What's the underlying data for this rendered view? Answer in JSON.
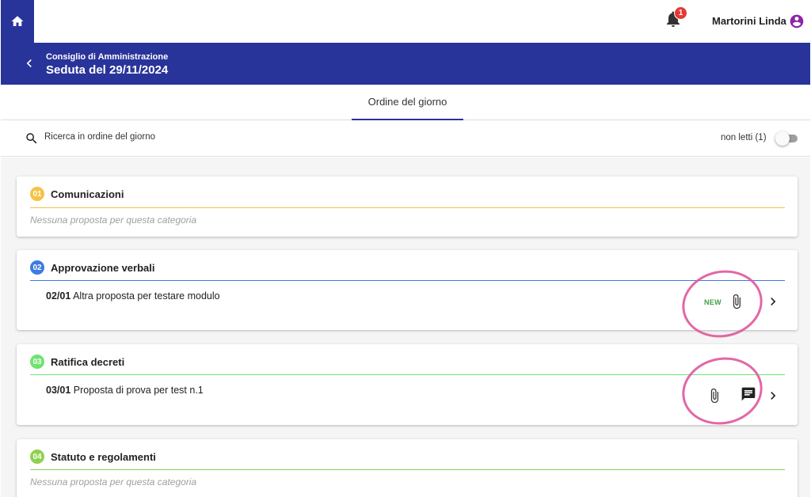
{
  "topbar": {
    "home_icon": "home-icon",
    "notification_count": "1",
    "user_name": "Martorini Linda"
  },
  "header": {
    "subtitle": "Consiglio di Amministrazione",
    "title": "Seduta del 29/11/2024"
  },
  "tabs": [
    {
      "label": "Ordine del giorno",
      "active": true
    }
  ],
  "search": {
    "placeholder": "Ricerca in ordine del giorno",
    "unread_label": "non letti (1)",
    "unread_toggle_on": false
  },
  "categories": [
    {
      "number": "01",
      "title": "Comunicazioni",
      "color": "#f5c242",
      "empty_text": "Nessuna proposta per questa categoria",
      "proposals": []
    },
    {
      "number": "02",
      "title": "Approvazione verbali",
      "color": "#3d7be0",
      "proposals": [
        {
          "code": "02/01",
          "text": "Altra proposta per testare modulo",
          "badge": "NEW",
          "icons": [
            "attachment-icon",
            "chevron-right-icon"
          ]
        }
      ]
    },
    {
      "number": "03",
      "title": "Ratifica decreti",
      "color": "#6ee36e",
      "proposals": [
        {
          "code": "03/01",
          "text": "Proposta di prova per test n.1",
          "icons": [
            "attachment-icon",
            "comment-icon",
            "chevron-right-icon"
          ]
        }
      ]
    },
    {
      "number": "04",
      "title": "Statuto e regolamenti",
      "color": "#8fd14f",
      "empty_text": "Nessuna proposta per questa categoria",
      "proposals": []
    }
  ],
  "colors": {
    "primary": "#29349a",
    "badge_red": "#e53935",
    "new_green": "#43a047",
    "annotation_pink": "#e0569c",
    "user_icon": "#8e24aa"
  }
}
